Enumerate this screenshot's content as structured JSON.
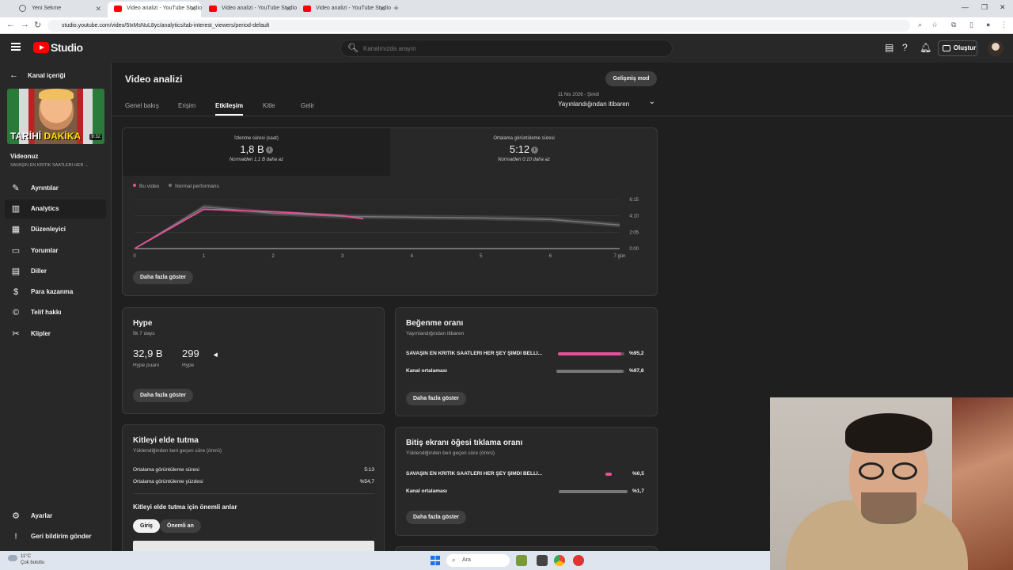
{
  "browser": {
    "tabs": [
      {
        "label": "Yeni Sekme",
        "active": false
      },
      {
        "label": "Video analizi - YouTube Studio",
        "active": true
      },
      {
        "label": "Video analizi - YouTube Studio",
        "active": false
      },
      {
        "label": "Video analizi - YouTube Studio",
        "active": false
      }
    ],
    "url": "studio.youtube.com/video/5IxMsNuL8yc/analytics/tab-interest_viewers/period-default"
  },
  "header": {
    "brand": "Studio",
    "search_placeholder": "Kanalınızda arayın",
    "create_label": "Oluştur"
  },
  "sidebar": {
    "back_label": "Kanal içeriği",
    "thumbnail": {
      "caption_white": "TARİHİ ",
      "caption_yellow": "DAKİKA",
      "duration": "9:32"
    },
    "video_title": "Videonuz",
    "video_subtitle": "SAVAŞIN EN KRİTİK SAATLERİ HER ...",
    "items": [
      {
        "label": "Ayrıntılar",
        "icon": "pencil-icon",
        "active": false
      },
      {
        "label": "Analytics",
        "icon": "analytics-icon",
        "active": true
      },
      {
        "label": "Düzenleyici",
        "icon": "editor-icon",
        "active": false
      },
      {
        "label": "Yorumlar",
        "icon": "comments-icon",
        "active": false
      },
      {
        "label": "Diller",
        "icon": "subtitles-icon",
        "active": false
      },
      {
        "label": "Para kazanma",
        "icon": "dollar-icon",
        "active": false
      },
      {
        "label": "Telif hakkı",
        "icon": "copyright-icon",
        "active": false
      },
      {
        "label": "Klipler",
        "icon": "scissors-icon",
        "active": false
      }
    ],
    "bottom_items": [
      {
        "label": "Ayarlar",
        "icon": "gear-icon"
      },
      {
        "label": "Geri bildirim gönder",
        "icon": "feedback-icon"
      }
    ]
  },
  "main": {
    "title": "Video analizi",
    "advanced_mode": "Gelişmiş mod",
    "tabs": [
      "Genel bakış",
      "Erişim",
      "Etkileşim",
      "Kitle",
      "Gelir"
    ],
    "active_tab": "Etkileşim",
    "period": {
      "dates": "11 Nis 2026 - Şimdi",
      "label": "Yayınlandığından itibaren"
    }
  },
  "engagement": {
    "metrics": [
      {
        "label": "İzlenme süresi (saat)",
        "value": "1,8 B",
        "comparison": "Normalden 1,1 B daha az",
        "selected": true
      },
      {
        "label": "Ortalama görüntüleme süresi",
        "value": "5:12",
        "comparison": "Normalden 0:10 daha az",
        "selected": false
      }
    ],
    "legend": [
      {
        "label": "Bu video",
        "color": "#e8509a"
      },
      {
        "label": "Normal performans",
        "color": "#777777"
      }
    ],
    "show_more": "Daha fazla göster"
  },
  "chart_data": {
    "type": "line",
    "x": [
      0,
      1,
      2,
      3,
      3.3,
      4,
      5,
      6,
      7
    ],
    "x_tick_labels": [
      "0",
      "1",
      "2",
      "3",
      "4",
      "5",
      "6",
      "7 gün"
    ],
    "y_tick_labels": [
      "0:00",
      "2:05",
      "4:10",
      "6:15"
    ],
    "ylim": [
      0,
      6.25
    ],
    "series": [
      {
        "name": "Bu video",
        "color": "#e8509a",
        "points": [
          [
            0,
            0
          ],
          [
            1,
            5.0
          ],
          [
            2,
            4.7
          ],
          [
            3,
            4.2
          ],
          [
            3.3,
            3.8
          ]
        ]
      },
      {
        "name": "Normal performans",
        "color": "#777777",
        "points": [
          [
            0,
            0
          ],
          [
            1,
            5.3
          ],
          [
            2,
            4.5
          ],
          [
            3,
            4.1
          ],
          [
            4,
            4.0
          ],
          [
            5,
            3.9
          ],
          [
            6,
            3.7
          ],
          [
            7,
            3.0
          ]
        ]
      }
    ]
  },
  "hype": {
    "title": "Hype",
    "subtitle": "İlk 7 days",
    "score_value": "32,9 B",
    "score_label": "Hype puanı",
    "count_value": "299",
    "count_label": "Hype",
    "show_more": "Daha fazla göster"
  },
  "likes": {
    "title": "Beğenme oranı",
    "subtitle": "Yayınlandığından itibaren",
    "rows": [
      {
        "label": "SAVAŞIN EN KRİTİK SAATLERİ HER ŞEY ŞİMDİ BELLİ...",
        "value": "%95,2",
        "fraction": 0.952,
        "color": "#e8509a"
      },
      {
        "label": "Kanal ortalaması",
        "value": "%97,8",
        "fraction": 0.978,
        "color": "#777777"
      }
    ],
    "show_more": "Daha fazla göster"
  },
  "endscreen": {
    "title": "Bitiş ekranı öğesi tıklama oranı",
    "subtitle": "Yüklendiğinden beri geçen süre (ömrü)",
    "rows": [
      {
        "label": "SAVAŞIN EN KRİTİK SAATLERİ HER ŞEY ŞİMDİ BELLİ...",
        "value": "%0,5",
        "fraction": 0.3,
        "color": "#e8509a"
      },
      {
        "label": "Kanal ortalaması",
        "value": "%1,7",
        "fraction": 1.0,
        "color": "#777777"
      }
    ],
    "show_more": "Daha fazla göster"
  },
  "retention": {
    "title": "Kitleyi elde tutma",
    "subtitle": "Yüklendiğinden beri geçen süre (ömrü)",
    "rows": [
      {
        "label": "Ortalama görüntüleme süresi",
        "value": "5:13"
      },
      {
        "label": "Ortalama görüntüleme yüzdesi",
        "value": "%54,7"
      }
    ],
    "key_moments_title": "Kitleyi elde tutma için önemli anlar",
    "chips": [
      "Giriş",
      "Önemli an"
    ]
  },
  "taskbar": {
    "temp": "11°C",
    "weather": "Çok bulutlu",
    "search": "Ara"
  }
}
